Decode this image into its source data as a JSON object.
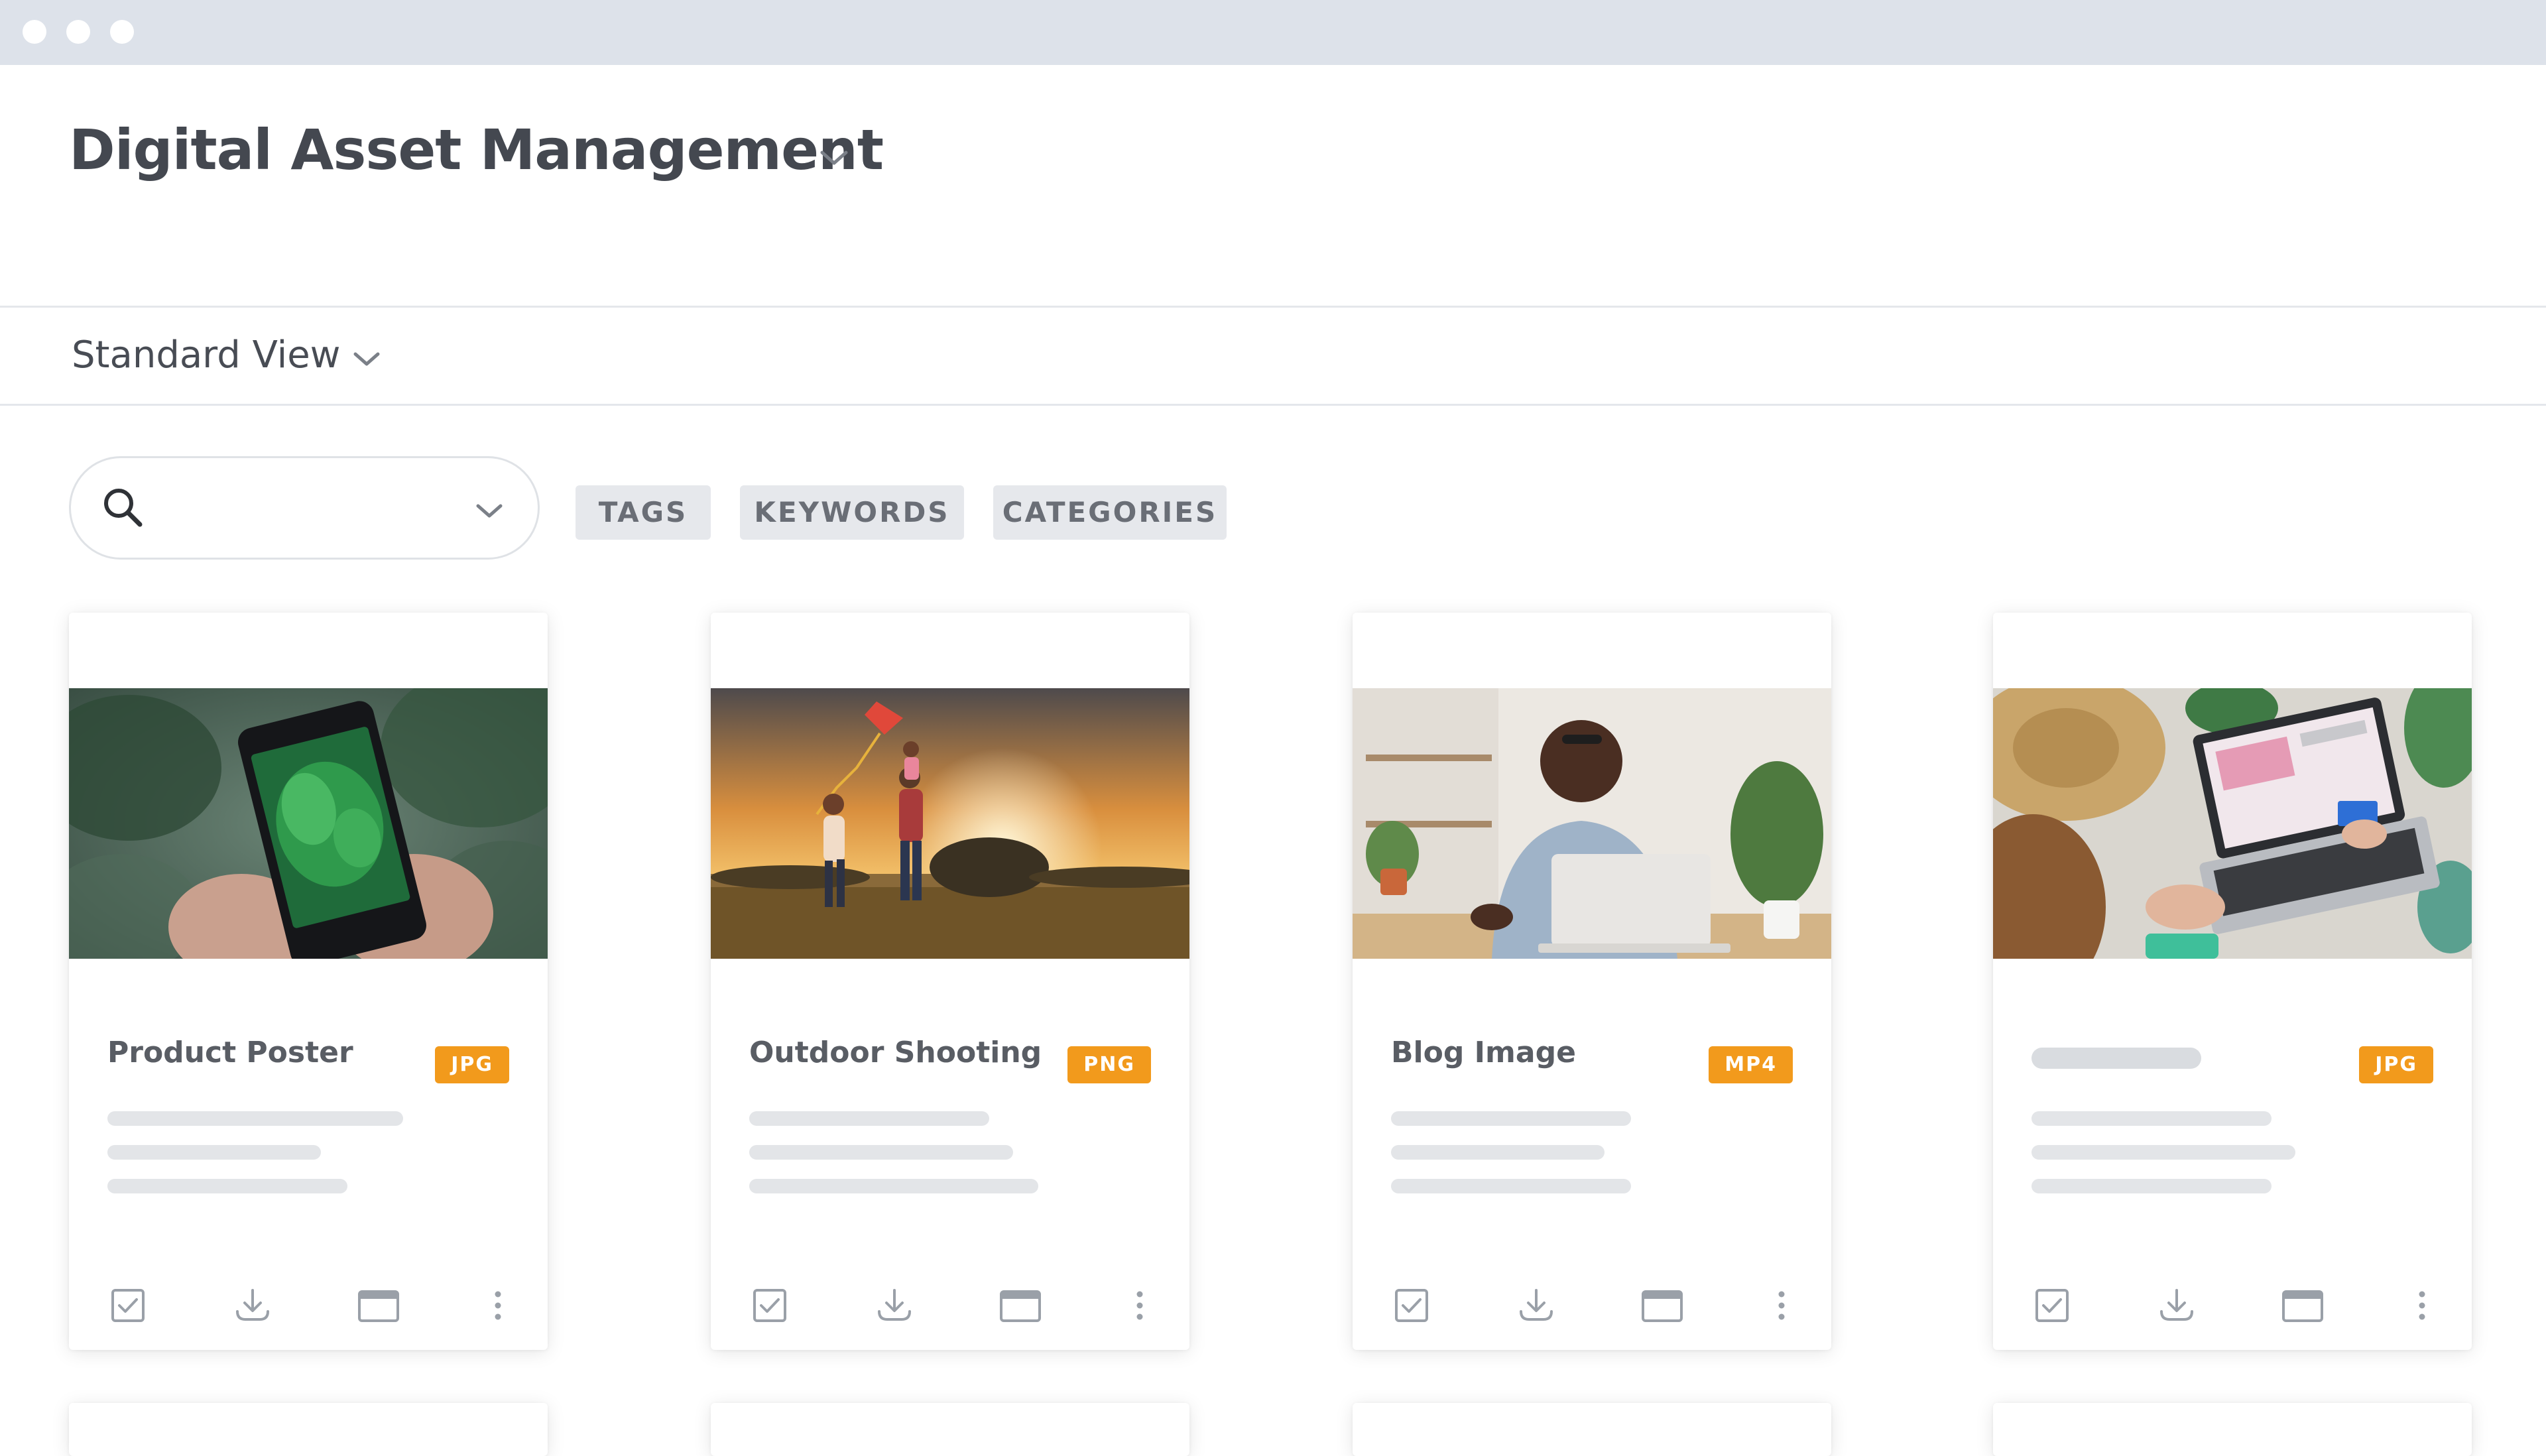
{
  "app": {
    "title": "Digital Asset Management"
  },
  "view": {
    "selected": "Standard View"
  },
  "search": {
    "value": "",
    "placeholder": ""
  },
  "filters": [
    "TAGS",
    "KEYWORDS",
    "CATEGORIES"
  ],
  "assets": [
    {
      "title": "Product Poster",
      "type": "JPG",
      "image": "hands holding phone photographing monstera plant"
    },
    {
      "title": "Outdoor Shooting",
      "type": "PNG",
      "image": "family running with kite in field at sunset"
    },
    {
      "title": "Blog Image",
      "type": "MP4",
      "image": "smiling man working on laptop at desk"
    },
    {
      "title": "",
      "type": "JPG",
      "image": "woman shopping online on laptop with credit card"
    }
  ],
  "card_actions": [
    "select-checkbox-icon",
    "download-icon",
    "preview-window-icon",
    "more-options-icon"
  ],
  "colors": {
    "badge": "#f29a1c",
    "window_bar": "#dde2ea",
    "chip_bg": "#e6e8ec"
  }
}
